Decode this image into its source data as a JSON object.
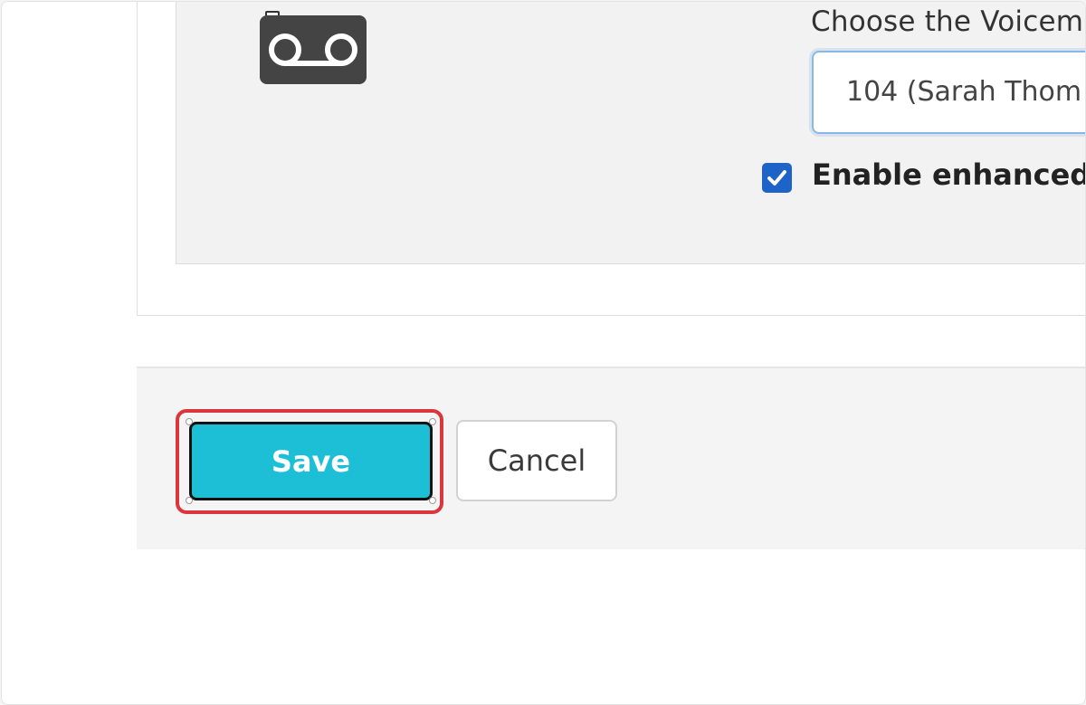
{
  "voicemail": {
    "icon": "voicemail-icon",
    "choose_label": "Choose the Voicem",
    "select_value": "104 (Sarah Thom",
    "enhanced_checked": true,
    "enhanced_label": "Enable enhanced v"
  },
  "actions": {
    "save_label": "Save",
    "cancel_label": "Cancel"
  },
  "colors": {
    "save_bg": "#1cbfd6",
    "highlight": "#d9363e",
    "checkbox": "#1e63c7"
  }
}
